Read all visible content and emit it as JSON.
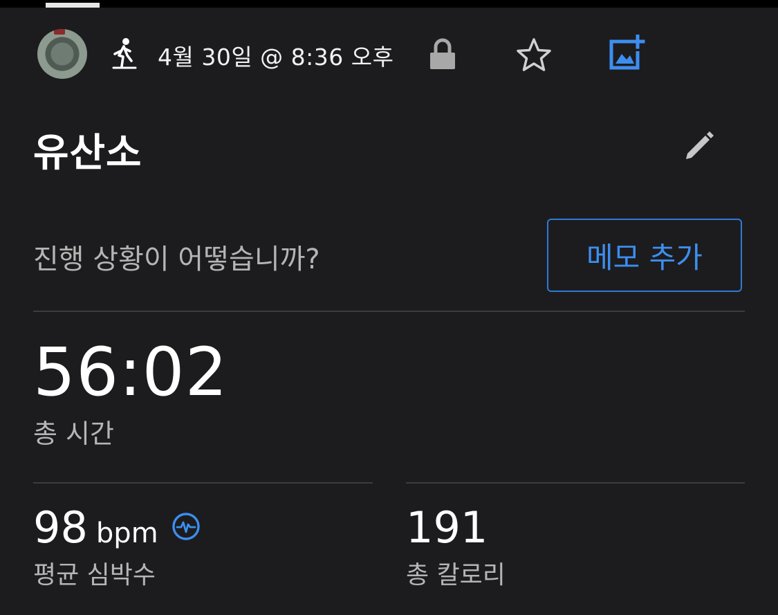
{
  "header": {
    "datetime": "4월 30일 @ 8:36 오후",
    "icons": {
      "activity": "walking-person-icon",
      "lock": "lock-icon",
      "star": "star-outline-icon",
      "add_photo": "add-photo-icon"
    }
  },
  "activity": {
    "title": "유산소",
    "edit_icon": "pencil-icon"
  },
  "notes": {
    "prompt": "진행 상황이 어떻습니까?",
    "add_memo_label": "메모 추가"
  },
  "stats": {
    "total_time": {
      "value": "56:02",
      "label": "총 시간"
    },
    "avg_heart_rate": {
      "value": "98",
      "unit": "bpm",
      "label": "평균 심박수",
      "icon": "heart-rate-icon"
    },
    "total_calories": {
      "value": "191",
      "label": "총 칼로리"
    }
  },
  "colors": {
    "background": "#1c1c1e",
    "accent": "#3d8ef0",
    "secondary_text": "#b5b5b5"
  }
}
